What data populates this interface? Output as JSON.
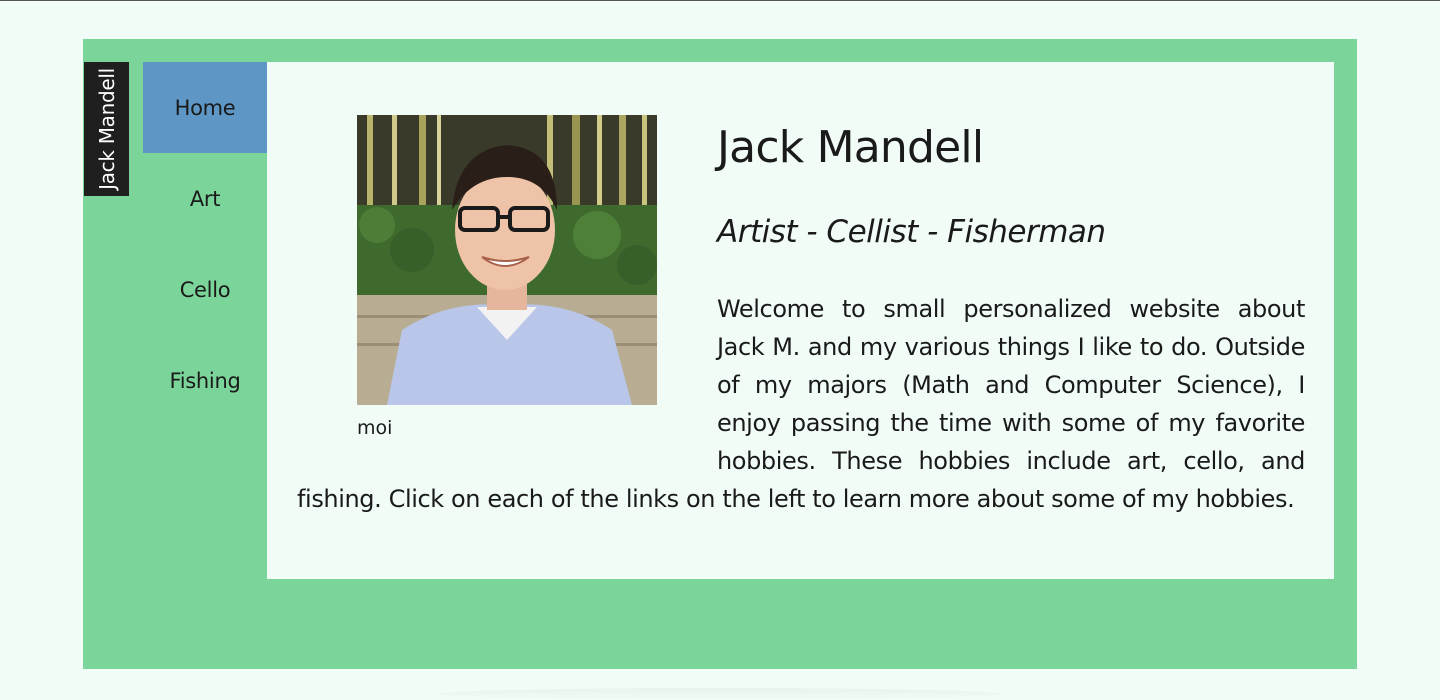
{
  "site": {
    "title": "Jack Mandell"
  },
  "nav": {
    "items": [
      {
        "label": "Home",
        "active": true
      },
      {
        "label": "Art",
        "active": false
      },
      {
        "label": "Cello",
        "active": false
      },
      {
        "label": "Fishing",
        "active": false
      }
    ]
  },
  "profile": {
    "name": "Jack Mandell",
    "tagline": "Artist - Cellist - Fisherman",
    "photo_caption": "moi",
    "intro": "Welcome to small personalized website about Jack M. and my various things I like to do. Outside of my majors (Math and Computer Science), I enjoy passing the time with some of my favorite hobbies. These hobbies include art, cello, and fishing. Click on each of the links on the left to learn more about some of my hobbies."
  },
  "colors": {
    "page_background": "#f1fcf7",
    "frame_green": "#7bd59a",
    "nav_active_blue": "#5e97c6",
    "site_tab_dark": "#1f1f1f"
  }
}
